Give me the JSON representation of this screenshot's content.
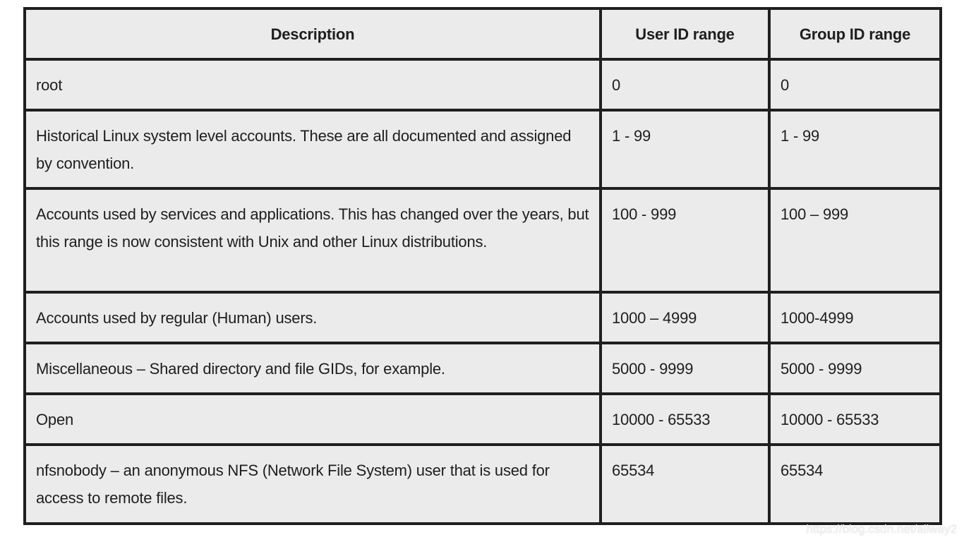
{
  "table": {
    "headers": [
      "Description",
      "User ID range",
      "Group ID range"
    ],
    "rows": [
      {
        "description": "root",
        "uid": "0",
        "gid": "0"
      },
      {
        "description": "Historical Linux system level accounts. These are all documented and assigned by convention.",
        "uid": "1 - 99",
        "gid": "1 - 99"
      },
      {
        "description": "Accounts used by services and applications. This has changed over the years, but this range is now consistent with Unix and other Linux distributions.",
        "uid": "100 - 999",
        "gid": "100 – 999"
      },
      {
        "description": "Accounts used by regular (Human) users.",
        "uid": "1000 – 4999",
        "gid": "1000-4999"
      },
      {
        "description": "Miscellaneous – Shared directory and file GIDs, for example.",
        "uid": "5000 - 9999",
        "gid": "5000 - 9999"
      },
      {
        "description": "Open",
        "uid": "10000 - 65533",
        "gid": "10000 - 65533"
      },
      {
        "description": "nfsnobody – an anonymous NFS (Network File System) user that is used for access to remote files.",
        "uid": "65534",
        "gid": "65534"
      }
    ]
  },
  "watermark": "https://blog.csdn.net/allway2",
  "colors": {
    "cell_background": "#ebebeb",
    "border": "#1f1f1f",
    "text": "#1e1e1e"
  }
}
